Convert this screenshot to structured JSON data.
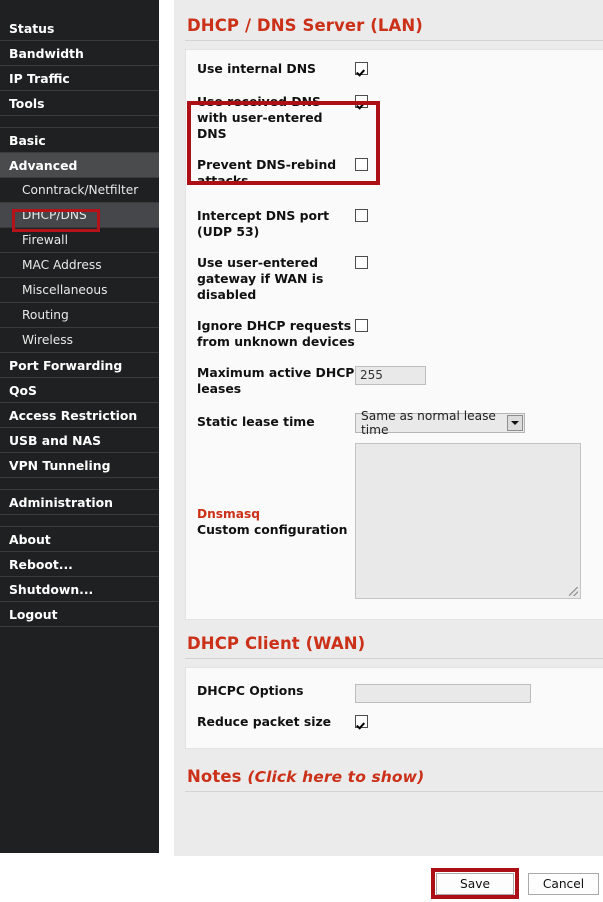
{
  "sidebar": {
    "items": [
      {
        "label": "Status",
        "type": "top",
        "active": false
      },
      {
        "label": "Bandwidth",
        "type": "top",
        "active": false
      },
      {
        "label": "IP Traffic",
        "type": "top",
        "active": false
      },
      {
        "label": "Tools",
        "type": "top",
        "active": false
      },
      {
        "label": "Basic",
        "type": "top",
        "active": false
      },
      {
        "label": "Advanced",
        "type": "top",
        "active": true
      },
      {
        "label": "Conntrack/Netfilter",
        "type": "sub",
        "active": false
      },
      {
        "label": "DHCP/DNS",
        "type": "sub",
        "active": true
      },
      {
        "label": "Firewall",
        "type": "sub",
        "active": false
      },
      {
        "label": "MAC Address",
        "type": "sub",
        "active": false
      },
      {
        "label": "Miscellaneous",
        "type": "sub",
        "active": false
      },
      {
        "label": "Routing",
        "type": "sub",
        "active": false
      },
      {
        "label": "Wireless",
        "type": "sub",
        "active": false
      },
      {
        "label": "Port Forwarding",
        "type": "top",
        "active": false
      },
      {
        "label": "QoS",
        "type": "top",
        "active": false
      },
      {
        "label": "Access Restriction",
        "type": "top",
        "active": false
      },
      {
        "label": "USB and NAS",
        "type": "top",
        "active": false
      },
      {
        "label": "VPN Tunneling",
        "type": "top",
        "active": false
      },
      {
        "label": "Administration",
        "type": "top",
        "active": false
      },
      {
        "label": "About",
        "type": "top",
        "active": false
      },
      {
        "label": "Reboot...",
        "type": "top",
        "active": false
      },
      {
        "label": "Shutdown...",
        "type": "top",
        "active": false
      },
      {
        "label": "Logout",
        "type": "top",
        "active": false
      }
    ]
  },
  "sections": {
    "lan": {
      "title": "DHCP / DNS Server (LAN)",
      "rows": {
        "use_internal_dns": {
          "label": "Use internal DNS",
          "checked": true
        },
        "use_received_dns": {
          "label": "Use received DNS with user-entered DNS",
          "checked": true
        },
        "prevent_rebind": {
          "label": "Prevent DNS-rebind attacks",
          "checked": false
        },
        "intercept_dns_port": {
          "label": "Intercept DNS port (UDP 53)",
          "checked": false
        },
        "user_gateway": {
          "label": "Use user-entered gateway if WAN is disabled",
          "checked": false
        },
        "ignore_dhcp": {
          "label": "Ignore DHCP requests from unknown devices",
          "checked": false
        },
        "max_leases": {
          "label": "Maximum active DHCP leases",
          "value": "255"
        },
        "static_lease_time": {
          "label": "Static lease time",
          "value": "Same as normal lease time"
        },
        "dnsmasq": {
          "label_top": "Dnsmasq",
          "label_bottom": "Custom configuration",
          "value": ""
        }
      }
    },
    "wan": {
      "title": "DHCP Client (WAN)",
      "rows": {
        "dhcpc_options": {
          "label": "DHCPC Options",
          "value": ""
        },
        "reduce_packet": {
          "label": "Reduce packet size",
          "checked": true
        }
      }
    },
    "notes": {
      "title": "Notes",
      "subtitle": "(Click here to show)"
    }
  },
  "footer": {
    "save_label": "Save",
    "cancel_label": "Cancel"
  },
  "colors": {
    "accent_red": "#cb3018",
    "highlight_red": "#ac1016",
    "sidebar_bg": "#1f2021"
  }
}
